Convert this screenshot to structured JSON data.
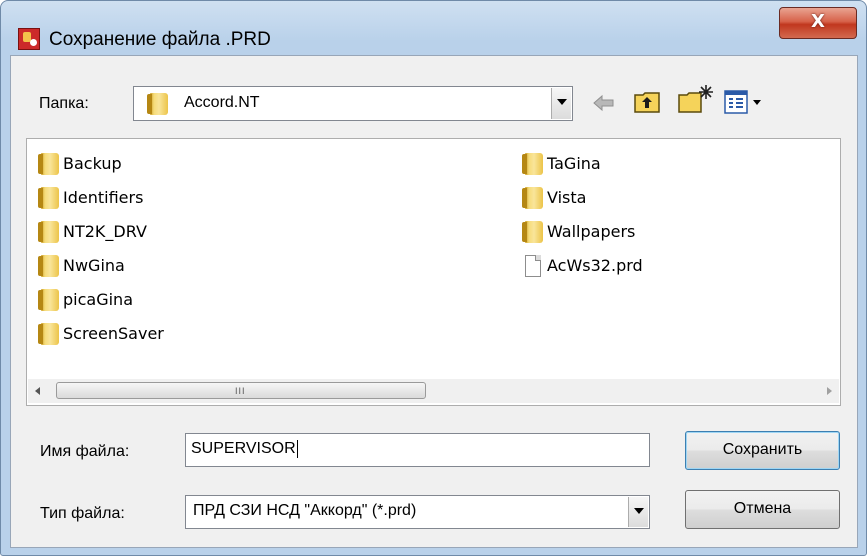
{
  "window": {
    "title": "Сохранение файла .PRD",
    "close_glyph": "X"
  },
  "location": {
    "label": "Папка:",
    "value": "Accord.NT"
  },
  "toolbar": {
    "icons": [
      "back-arrow-icon",
      "up-folder-icon",
      "new-folder-icon",
      "view-menu-icon"
    ]
  },
  "files": {
    "col1": [
      {
        "name": "Backup",
        "type": "folder"
      },
      {
        "name": "Identifiers",
        "type": "folder"
      },
      {
        "name": "NT2K_DRV",
        "type": "folder"
      },
      {
        "name": "NwGina",
        "type": "folder"
      },
      {
        "name": "picaGina",
        "type": "folder"
      },
      {
        "name": "ScreenSaver",
        "type": "folder"
      }
    ],
    "col2": [
      {
        "name": "TaGina",
        "type": "folder"
      },
      {
        "name": "Vista",
        "type": "folder"
      },
      {
        "name": "Wallpapers",
        "type": "folder"
      },
      {
        "name": "AcWs32.prd",
        "type": "file"
      }
    ]
  },
  "scrollbar": {
    "grip": "III"
  },
  "filename": {
    "label": "Имя файла:",
    "value": "SUPERVISOR"
  },
  "filetype": {
    "label": "Тип файла:",
    "value": "ПРД СЗИ НСД \"Аккорд\" (*.prd)"
  },
  "buttons": {
    "save": "Сохранить",
    "cancel": "Отмена"
  },
  "colors": {
    "title_bg": "#b9d1ea",
    "client_bg": "#f0f0f0",
    "close_red": "#c1371e"
  }
}
